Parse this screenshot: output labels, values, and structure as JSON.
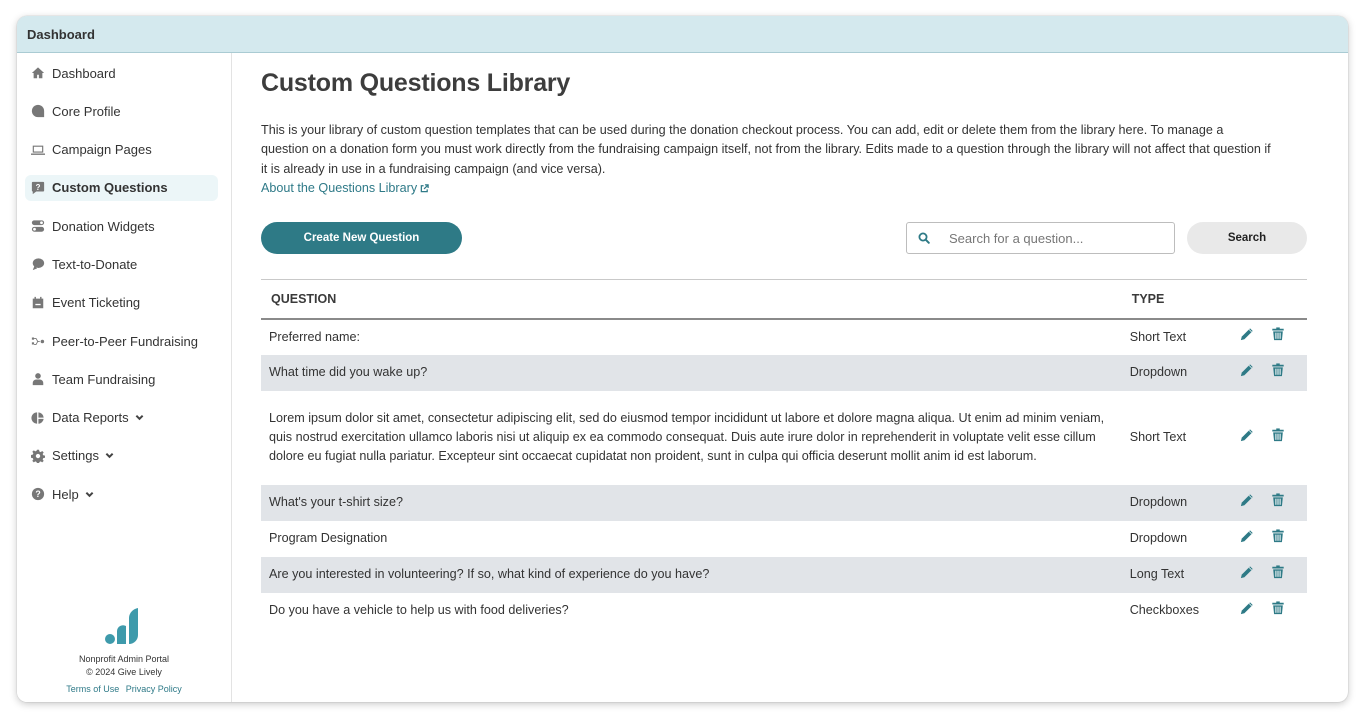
{
  "window": {
    "title": "Dashboard"
  },
  "sidebar": {
    "items": [
      {
        "label": "Dashboard",
        "icon": "home-icon"
      },
      {
        "label": "Core Profile",
        "icon": "profile-icon"
      },
      {
        "label": "Campaign Pages",
        "icon": "laptop-icon"
      },
      {
        "label": "Custom Questions",
        "icon": "question-comment-icon",
        "active": true
      },
      {
        "label": "Donation Widgets",
        "icon": "toggle-icon"
      },
      {
        "label": "Text-to-Donate",
        "icon": "chat-bubble-icon"
      },
      {
        "label": "Event Ticketing",
        "icon": "calendar-icon"
      },
      {
        "label": "Peer-to-Peer Fundraising",
        "icon": "p2p-icon"
      },
      {
        "label": "Team Fundraising",
        "icon": "user-icon"
      },
      {
        "label": "Data Reports",
        "icon": "pie-chart-icon",
        "expandable": true
      },
      {
        "label": "Settings",
        "icon": "gear-icon",
        "expandable": true
      },
      {
        "label": "Help",
        "icon": "help-circle-icon",
        "expandable": true
      }
    ],
    "footer": {
      "portal_name": "Nonprofit Admin Portal",
      "copyright": "© 2024 Give Lively",
      "terms_label": "Terms of Use",
      "privacy_label": "Privacy Policy"
    }
  },
  "main": {
    "title": "Custom Questions Library",
    "description": "This is your library of custom question templates that can be used during the donation checkout process. You can add, edit or delete them from the library here. To manage a question on a donation form you must work directly from the fundraising campaign itself, not from the library. Edits made to a question through the library will not affect that question if it is already in use in a fundraising campaign (and vice versa).",
    "about_link": "About the Questions Library",
    "create_button": "Create New Question",
    "search": {
      "placeholder": "Search for a question...",
      "value": "",
      "button": "Search"
    },
    "table": {
      "headers": {
        "question": "QUESTION",
        "type": "TYPE"
      },
      "rows": [
        {
          "question": "Preferred name:",
          "type": "Short Text"
        },
        {
          "question": "What time did you wake up?",
          "type": "Dropdown"
        },
        {
          "question": "Lorem ipsum dolor sit amet, consectetur adipiscing elit, sed do eiusmod tempor incididunt ut labore et dolore magna aliqua. Ut enim ad minim veniam, quis nostrud exercitation ullamco laboris nisi ut aliquip ex ea commodo consequat. Duis aute irure dolor in reprehenderit in voluptate velit esse cillum dolore eu fugiat nulla pariatur. Excepteur sint occaecat cupidatat non proident, sunt in culpa qui officia deserunt mollit anim id est laborum.",
          "type": "Short Text"
        },
        {
          "question": "What's your t-shirt size?",
          "type": "Dropdown"
        },
        {
          "question": "Program Designation",
          "type": "Dropdown"
        },
        {
          "question": "Are you interested in volunteering? If so, what kind of experience do you have?",
          "type": "Long Text"
        },
        {
          "question": "Do you have a vehicle to help us with food deliveries?",
          "type": "Checkboxes"
        }
      ]
    }
  },
  "colors": {
    "accent": "#2e7a86",
    "titlebar": "#d4e9ee",
    "row_alt": "#e1e4e8",
    "active_nav": "#ecf6f8"
  }
}
